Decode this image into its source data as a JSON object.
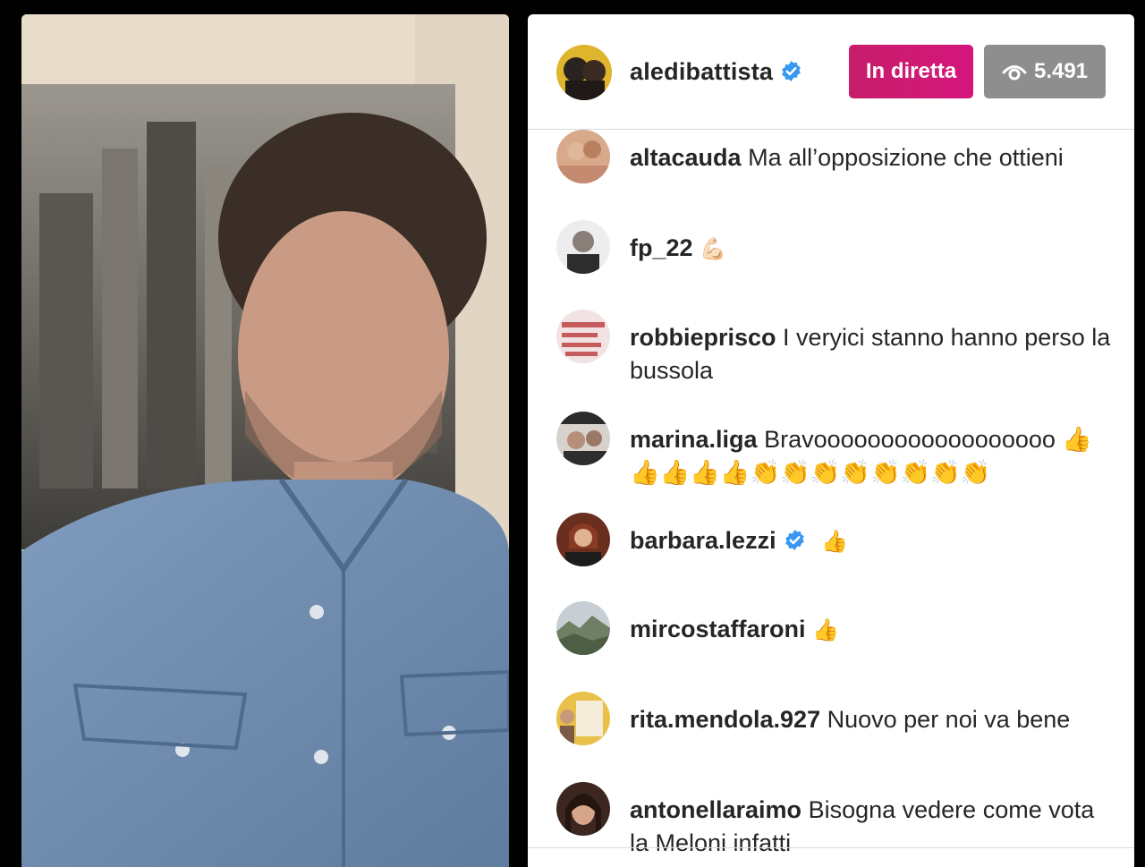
{
  "header": {
    "username": "aledibattista",
    "live_label": "In diretta",
    "viewer_count": "5.491"
  },
  "comments": [
    {
      "username": "altacauda",
      "text": "Ma all’opposizione che ottieni"
    },
    {
      "username": "fp_22",
      "text": "💪🏻"
    },
    {
      "username": "robbieprisco",
      "text": "I veryici stanno hanno perso la bussola"
    },
    {
      "username": "marina.liga",
      "text": "Bravoooooooooooooooooo 👍👍👍👍👍👏👏👏👏👏👏👏👏"
    },
    {
      "username": "barbara.lezzi",
      "text": "👍",
      "verified": true
    },
    {
      "username": "mircostaffaroni",
      "text": "👍"
    },
    {
      "username": "rita.mendola.927",
      "text": "Nuovo per noi va bene"
    },
    {
      "username": "antonellaraimo",
      "text": "Bisogna vedere come vota la Meloni infatti"
    }
  ],
  "colors": {
    "live": "#d4167c",
    "verified": "#3897f0",
    "viewer_badge": "#8e8e8e"
  },
  "icons": {
    "verified": "verified-badge-icon",
    "views": "eye-icon"
  }
}
